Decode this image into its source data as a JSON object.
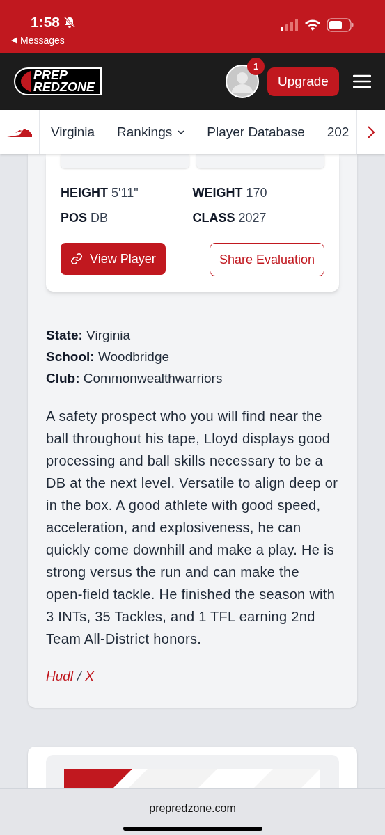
{
  "status_bar": {
    "time": "1:58",
    "back_label": "Messages"
  },
  "header": {
    "logo": [
      "PREP",
      "REDZONE"
    ],
    "notification_count": "1",
    "upgrade_label": "Upgrade"
  },
  "nav": {
    "items": [
      {
        "label": "Virginia",
        "dropdown": false
      },
      {
        "label": "Rankings",
        "dropdown": true
      },
      {
        "label": "Player Database",
        "dropdown": false
      },
      {
        "label": "202",
        "dropdown": false
      }
    ]
  },
  "player_card": {
    "stats": [
      {
        "label": "HEIGHT",
        "value": "5'11\""
      },
      {
        "label": "WEIGHT",
        "value": "170"
      },
      {
        "label": "POS",
        "value": "DB"
      },
      {
        "label": "CLASS",
        "value": "2027"
      }
    ],
    "view_button": "View Player",
    "share_button": "Share Evaluation"
  },
  "details": [
    {
      "label": "State:",
      "value": "Virginia"
    },
    {
      "label": "School:",
      "value": "Woodbridge"
    },
    {
      "label": "Club:",
      "value": "Commonwealthwarriors"
    }
  ],
  "evaluation": "A safety prospect who you will find near the ball throughout his tape, Lloyd displays good processing and ball skills necessary to be a DB at the next level. Versatile to align deep or in the box. A good athlete with good speed, acceleration, and explosiveness, he can quickly come downhill and make a play. He is strong versus the run and can make the open-field tackle. He finished the season with 3 INTs, 35 Tackles, and 1 TFL earning 2nd Team All-District honors.",
  "links": [
    "Hudl",
    "X"
  ],
  "link_separator": "/",
  "browser_bar": {
    "url": "prepredzone.com"
  }
}
